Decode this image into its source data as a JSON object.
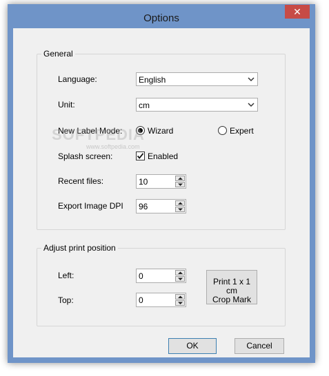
{
  "window": {
    "title": "Options",
    "close_glyph": "✕"
  },
  "general": {
    "caption": "General",
    "language_label": "Language:",
    "language_value": "English",
    "unit_label": "Unit:",
    "unit_value": "cm",
    "new_label_mode_label": "New Label Mode:",
    "mode_options": [
      {
        "label": "Wizard",
        "checked": true
      },
      {
        "label": "Expert",
        "checked": false
      }
    ],
    "splash_label": "Splash screen:",
    "splash_checkbox_label": "Enabled",
    "splash_enabled": true,
    "recent_files_label": "Recent files:",
    "recent_files_value": "10",
    "export_dpi_label": "Export Image DPI",
    "export_dpi_value": "96"
  },
  "print_position": {
    "caption": "Adjust print position",
    "left_label": "Left:",
    "left_value": "0",
    "top_label": "Top:",
    "top_value": "0",
    "crop_mark_line1": "Print 1 x 1 cm",
    "crop_mark_line2": "Crop Mark"
  },
  "footer": {
    "ok_label": "OK",
    "cancel_label": "Cancel"
  },
  "watermark": {
    "text": "SOFTPEDIA",
    "sub": "www.softpedia.com"
  },
  "colors": {
    "frame": "#6f94c8",
    "close": "#c74b46",
    "client": "#f0f0f0"
  }
}
